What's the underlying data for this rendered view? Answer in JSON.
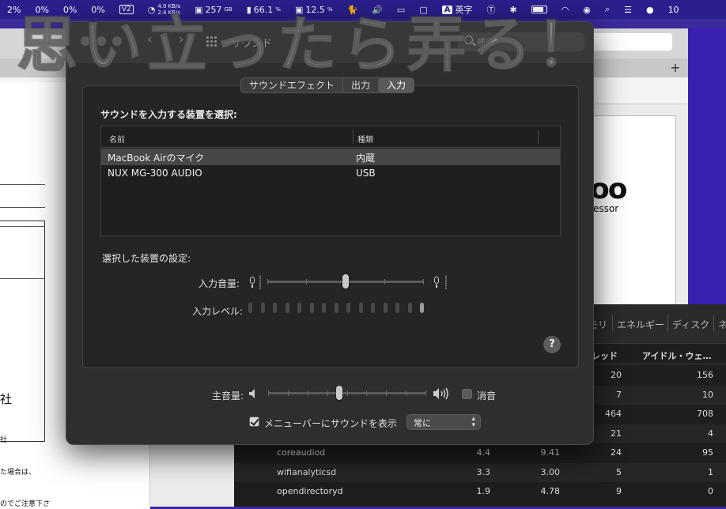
{
  "menubar": {
    "cpu_items": [
      "2%",
      "0%",
      "0%",
      "0%"
    ],
    "v2_label": "V2",
    "net_up": "4.0 KB/s",
    "net_down": "2.4 KB/s",
    "disk": "257",
    "disk_unit": "GB",
    "mem": "66.1",
    "mem_unit": "%",
    "cpu_total": "12.5",
    "cpu_unit": "%",
    "input_source_letter": "A",
    "input_source_label": "英字",
    "clock": "10"
  },
  "sound_window": {
    "title": "サウンド",
    "search_placeholder": "検索",
    "tabs": [
      {
        "label": "サウンドエフェクト",
        "active": false
      },
      {
        "label": "出力",
        "active": false
      },
      {
        "label": "入力",
        "active": true
      }
    ],
    "select_device_label": "サウンドを入力する装置を選択:",
    "table": {
      "columns": [
        "名前",
        "種類"
      ],
      "rows": [
        {
          "name": "MacBook Airのマイク",
          "type": "内蔵",
          "selected": true
        },
        {
          "name": "NUX MG-300 AUDIO",
          "type": "USB",
          "selected": false
        }
      ]
    },
    "selected_settings_label": "選択した装置の設定:",
    "input_volume_label": "入力音量:",
    "input_volume_level": 0.5,
    "input_level_label": "入力レベル:",
    "input_level_segments_total": 15,
    "input_level_segments_lit": 1,
    "help_label": "?",
    "output_volume_label": "主音量:",
    "output_volume_level": 0.45,
    "mute_label": "消音",
    "mute_checked": false,
    "menubar_checkbox_label": "メニューバーにサウンドを表示",
    "menubar_checkbox_checked": true,
    "menubar_popup_value": "常に"
  },
  "activity_monitor": {
    "tabs": [
      "モリ",
      "エネルギー",
      "ディスク",
      "ネ"
    ],
    "headers": [
      "レッド",
      "アイドル・ウェ…"
    ],
    "rows": [
      {
        "name": "",
        "c1": "",
        "c2": "",
        "c3": "20",
        "c4": "156"
      },
      {
        "name": "",
        "c1": "",
        "c2": "",
        "c3": "7",
        "c4": "10"
      },
      {
        "name": "",
        "c1": "",
        "c2": "",
        "c3": "464",
        "c4": "708"
      },
      {
        "name": "",
        "c1": "",
        "c2": "",
        "c3": "21",
        "c4": "4"
      },
      {
        "name": "coreaudiod",
        "c1": "4.4",
        "c2": "9.41",
        "c3": "24",
        "c4": "95"
      },
      {
        "name": "wifianalyticsd",
        "c1": "3.3",
        "c2": "3.00",
        "c3": "5",
        "c4": "1"
      },
      {
        "name": "opendirectoryd",
        "c1": "1.9",
        "c2": "4.78",
        "c3": "9",
        "c4": "0"
      }
    ]
  },
  "background_doc": {
    "company_char": "社",
    "company_char_small": "社",
    "note1": "た場合は、",
    "note2": "のでご注意下さ",
    "logo_text": "oo",
    "logo_sub": "essor"
  },
  "watermark_text": "思い立ったら弄る！"
}
